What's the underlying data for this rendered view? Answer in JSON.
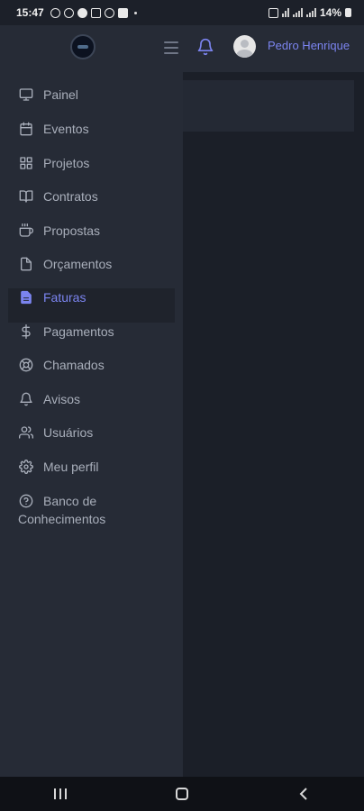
{
  "status_bar": {
    "time": "15:47",
    "battery": "14%"
  },
  "header": {
    "username": "Pedro Henrique",
    "icons": [
      "hamburger-icon",
      "bell-icon",
      "avatar"
    ]
  },
  "sidebar": {
    "items": [
      {
        "label": "Painel",
        "icon": "monitor-icon"
      },
      {
        "label": "Eventos",
        "icon": "calendar-icon"
      },
      {
        "label": "Projetos",
        "icon": "grid-icon"
      },
      {
        "label": "Contratos",
        "icon": "book-icon"
      },
      {
        "label": "Propostas",
        "icon": "coffee-icon"
      },
      {
        "label": "Orçamentos",
        "icon": "file-icon"
      },
      {
        "label": "Faturas",
        "icon": "file-text-icon",
        "active": true
      },
      {
        "label": "Pagamentos",
        "icon": "dollar-icon"
      },
      {
        "label": "Chamados",
        "icon": "lifebuoy-icon"
      },
      {
        "label": "Avisos",
        "icon": "bell-icon"
      },
      {
        "label": "Usuários",
        "icon": "users-icon"
      },
      {
        "label": "Meu perfil",
        "icon": "gear-icon"
      },
      {
        "label": "Banco de Conhecimentos",
        "label_line1": "Banco de",
        "label_line2": "Conhecimentos",
        "icon": "help-circle-icon"
      }
    ]
  },
  "colors": {
    "accent": "#7b84ef",
    "sidebar_bg": "#262b36",
    "content_bg": "#1b1f28",
    "text_muted": "#a9afbb"
  }
}
